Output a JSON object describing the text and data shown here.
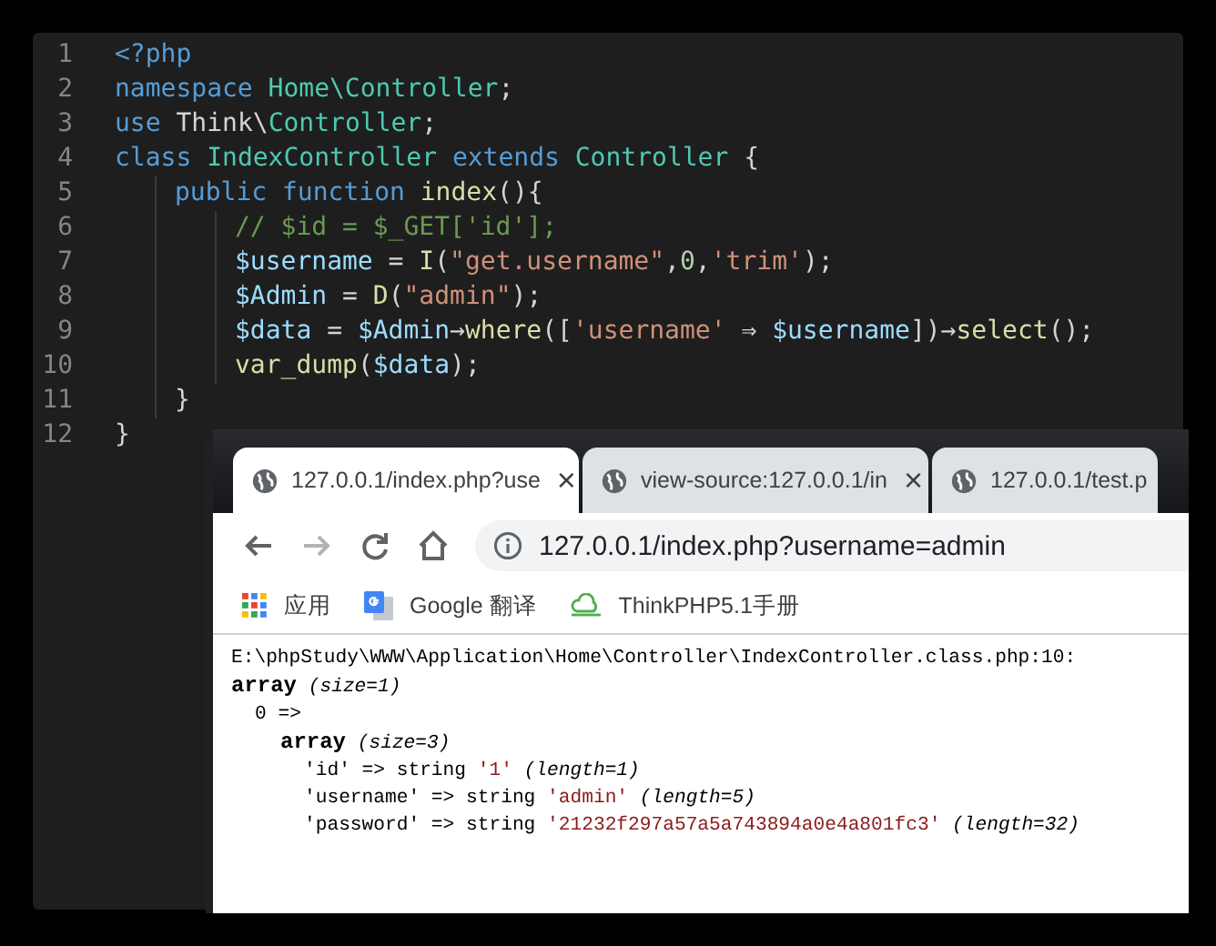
{
  "editor": {
    "lines": [
      {
        "number": "1",
        "tokens": [
          {
            "kind": "keyword",
            "text": "<?php"
          }
        ]
      },
      {
        "number": "2",
        "tokens": [
          {
            "kind": "keyword",
            "text": "namespace"
          },
          {
            "kind": "type",
            "text": " Home\\Controller"
          },
          {
            "kind": "plain",
            "text": ";"
          }
        ]
      },
      {
        "number": "3",
        "tokens": [
          {
            "kind": "keyword",
            "text": "use"
          },
          {
            "kind": "plain",
            "text": " Think\\"
          },
          {
            "kind": "type",
            "text": "Controller"
          },
          {
            "kind": "plain",
            "text": ";"
          }
        ]
      },
      {
        "number": "4",
        "tokens": [
          {
            "kind": "keyword",
            "text": "class"
          },
          {
            "kind": "type",
            "text": " IndexController"
          },
          {
            "kind": "keyword",
            "text": " extends"
          },
          {
            "kind": "type",
            "text": " Controller"
          },
          {
            "kind": "plain",
            "text": " {"
          }
        ],
        "children": [
          {
            "number": "5",
            "tokens": [
              {
                "kind": "keyword",
                "text": "public"
              },
              {
                "kind": "keyword",
                "text": " function"
              },
              {
                "kind": "func",
                "text": " index"
              },
              {
                "kind": "plain",
                "text": "(){"
              }
            ],
            "children": [
              {
                "number": "6",
                "tokens": [
                  {
                    "kind": "comment",
                    "text": "// $id = $_GET['id'];"
                  }
                ]
              },
              {
                "number": "7",
                "tokens": [
                  {
                    "kind": "variable",
                    "text": "$username"
                  },
                  {
                    "kind": "plain",
                    "text": " = "
                  },
                  {
                    "kind": "func",
                    "text": "I"
                  },
                  {
                    "kind": "plain",
                    "text": "("
                  },
                  {
                    "kind": "string",
                    "text": "\"get.username\""
                  },
                  {
                    "kind": "plain",
                    "text": ","
                  },
                  {
                    "kind": "number",
                    "text": "0"
                  },
                  {
                    "kind": "plain",
                    "text": ","
                  },
                  {
                    "kind": "string",
                    "text": "'trim'"
                  },
                  {
                    "kind": "plain",
                    "text": ");"
                  }
                ]
              },
              {
                "number": "8",
                "tokens": [
                  {
                    "kind": "variable",
                    "text": "$Admin"
                  },
                  {
                    "kind": "plain",
                    "text": " = "
                  },
                  {
                    "kind": "func",
                    "text": "D"
                  },
                  {
                    "kind": "plain",
                    "text": "("
                  },
                  {
                    "kind": "string",
                    "text": "\"admin\""
                  },
                  {
                    "kind": "plain",
                    "text": ");"
                  }
                ]
              },
              {
                "number": "9",
                "tokens": [
                  {
                    "kind": "variable",
                    "text": "$data"
                  },
                  {
                    "kind": "plain",
                    "text": " = "
                  },
                  {
                    "kind": "variable",
                    "text": "$Admin"
                  },
                  {
                    "kind": "plain",
                    "text": "→"
                  },
                  {
                    "kind": "func",
                    "text": "where"
                  },
                  {
                    "kind": "plain",
                    "text": "(["
                  },
                  {
                    "kind": "string",
                    "text": "'username'"
                  },
                  {
                    "kind": "plain",
                    "text": " ⇒ "
                  },
                  {
                    "kind": "variable",
                    "text": "$username"
                  },
                  {
                    "kind": "plain",
                    "text": "])→"
                  },
                  {
                    "kind": "func",
                    "text": "select"
                  },
                  {
                    "kind": "plain",
                    "text": "();"
                  }
                ]
              },
              {
                "number": "10",
                "tokens": [
                  {
                    "kind": "func",
                    "text": "var_dump"
                  },
                  {
                    "kind": "plain",
                    "text": "("
                  },
                  {
                    "kind": "variable",
                    "text": "$data"
                  },
                  {
                    "kind": "plain",
                    "text": ");"
                  }
                ]
              }
            ]
          },
          {
            "number": "11",
            "tokens": [
              {
                "kind": "plain",
                "text": "}"
              }
            ]
          }
        ]
      },
      {
        "number": "12",
        "tokens": [
          {
            "kind": "plain",
            "text": "}"
          }
        ]
      }
    ]
  },
  "browser": {
    "tabs": [
      {
        "title": "127.0.0.1/index.php?use",
        "close": "×",
        "selected": true
      },
      {
        "title": "view-source:127.0.0.1/in",
        "close": "×",
        "selected": false
      },
      {
        "title": "127.0.0.1/test.p",
        "selected": false
      }
    ],
    "nav_buttons": [
      {
        "kind": "back",
        "disabled": false
      },
      {
        "kind": "forward",
        "disabled": true
      },
      {
        "kind": "reload",
        "disabled": false
      },
      {
        "kind": "home",
        "disabled": false
      }
    ],
    "address": "127.0.0.1/index.php?username=admin",
    "bookmarks": [
      {
        "kind": "apps",
        "label": "应用"
      },
      {
        "kind": "translate",
        "label": "Google 翻译"
      },
      {
        "kind": "cloud",
        "label": "ThinkPHP5.1手册"
      }
    ],
    "dump": {
      "path": "E:\\phpStudy\\WWW\\Application\\Home\\Controller\\IndexController.class.php:10:",
      "outer": {
        "label": "array",
        "size": "(size=1)"
      },
      "index": "0 =>",
      "inner": {
        "label": "array",
        "size": "(size=3)"
      },
      "entries": [
        {
          "key": "'id'",
          "arrow": "=>",
          "type": "string",
          "value": "'1'",
          "length": "(length=1)"
        },
        {
          "key": "'username'",
          "arrow": "=>",
          "type": "string",
          "value": "'admin'",
          "length": "(length=5)"
        },
        {
          "key": "'password'",
          "arrow": "=>",
          "type": "string",
          "value": "'21232f297a57a5a743894a0e4a801fc3'",
          "length": "(length=32)"
        }
      ]
    }
  }
}
